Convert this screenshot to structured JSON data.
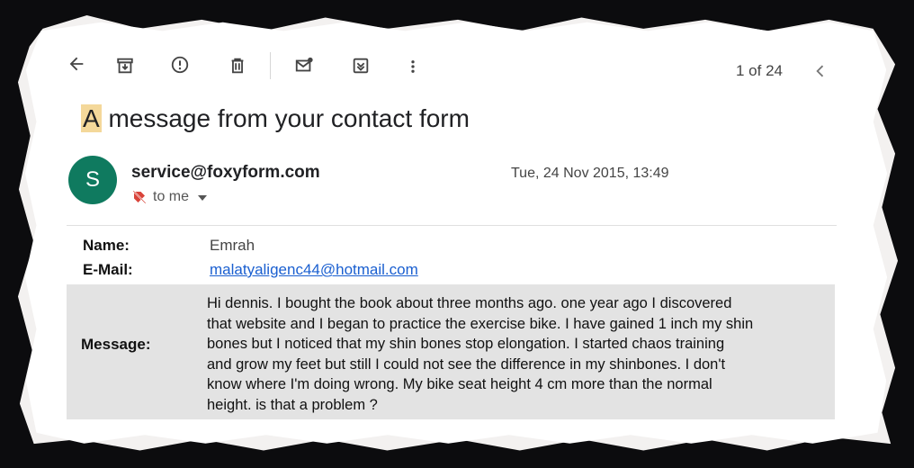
{
  "toolbar": {
    "icons": [
      "back-arrow-icon",
      "archive-icon",
      "report-spam-icon",
      "delete-icon",
      "mark-unread-icon",
      "move-to-icon",
      "more-vert-icon"
    ],
    "counter": "1 of 24",
    "prev_icon": "chevron-left-icon"
  },
  "email": {
    "subject_first": "A",
    "subject_rest": " message from your contact form",
    "avatar_letter": "S",
    "sender": "service@foxyform.com",
    "date": "Tue, 24 Nov 2015, 13:49",
    "to": "to me",
    "fields": {
      "name_label": "Name:",
      "name_value": "Emrah",
      "email_label": "E-Mail:",
      "email_value": "malatyaligenc44@hotmail.com",
      "message_label": "Message:",
      "message_lines": [
        "Hi dennis. I bought the book about three months ago. one year ago I discovered",
        "that website and I began to practice the exercise bike. I have gained 1 inch my shin",
        "bones but I noticed that my shin bones stop elongation. I started chaos training",
        "and grow my feet but still I could not see the difference in my shinbones. I don't",
        "know where I'm doing wrong. My bike seat height 4 cm more than the normal",
        "height. is that a problem ?"
      ]
    }
  },
  "colors": {
    "avatar": "#0f7a5f",
    "link": "#1a5fd0",
    "highlight": "#f4d89a",
    "message_bg": "#e3e3e3"
  }
}
